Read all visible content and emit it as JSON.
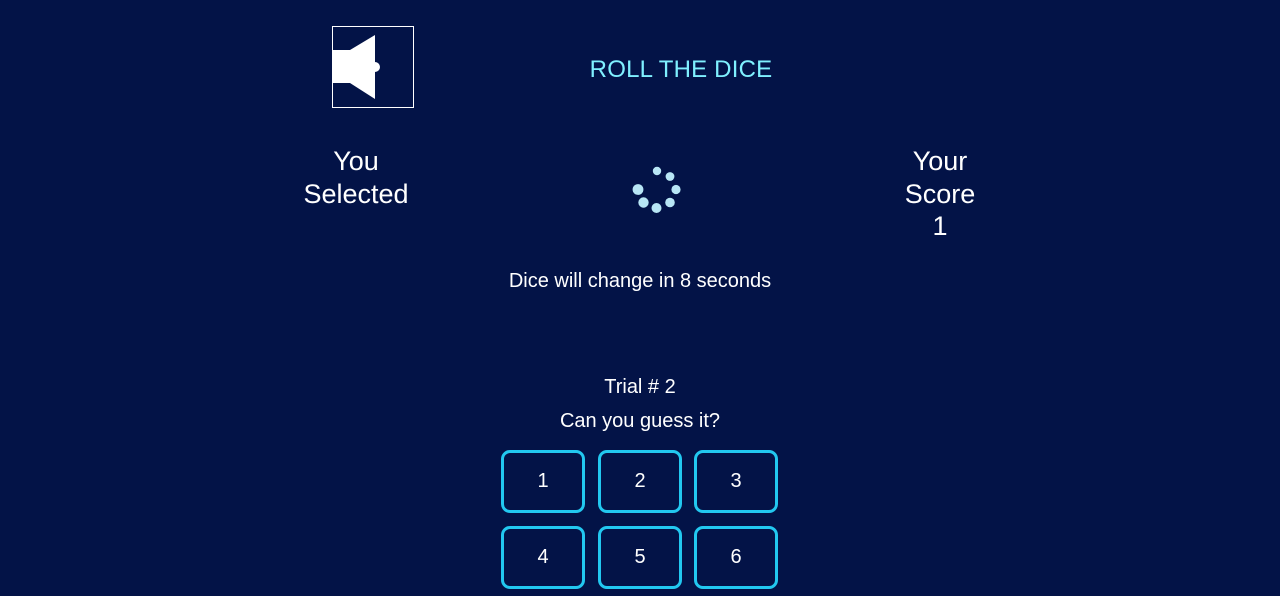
{
  "game": {
    "title": "ROLL THE DICE",
    "sound_icon": "speaker-muted-icon"
  },
  "selected": {
    "line1": "You",
    "line2": "Selected"
  },
  "score": {
    "line1": "Your",
    "line2": "Score",
    "value": "1"
  },
  "status": {
    "timer_text": "Dice will change in 8 seconds",
    "loading_icon": "loading-spinner-icon"
  },
  "guess": {
    "trial_text": "Trial # 2",
    "prompt": "Can you guess it?",
    "options": [
      "1",
      "2",
      "3",
      "4",
      "5",
      "6"
    ]
  },
  "colors": {
    "background": "#031347",
    "title": "#7ff0ff",
    "button_border": "#22c8f0",
    "text": "#ffffff",
    "spinner": "#b8e6f5"
  }
}
